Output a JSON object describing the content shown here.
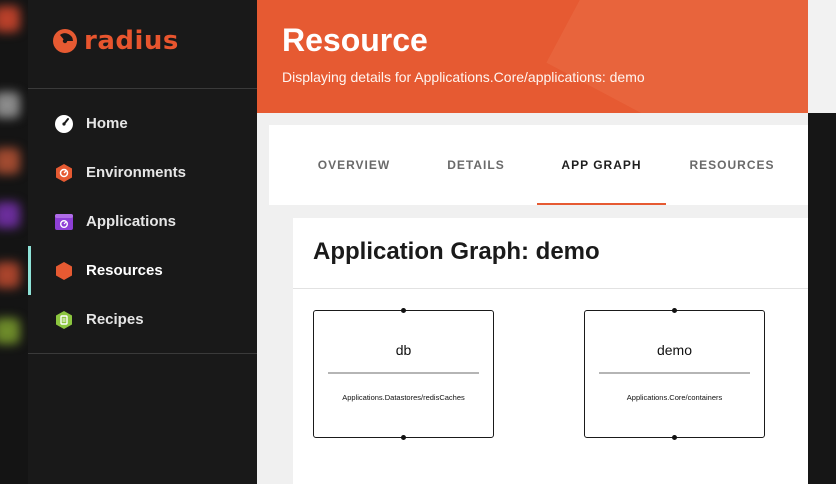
{
  "brand": {
    "name": "radius",
    "accent": "#e65a32",
    "active_marker": "#8fe3d8"
  },
  "sidebar": {
    "items": [
      {
        "label": "Home",
        "icon": "gauge-icon",
        "active": false
      },
      {
        "label": "Environments",
        "icon": "environments-hexagon-icon",
        "active": false
      },
      {
        "label": "Applications",
        "icon": "applications-window-icon",
        "active": false
      },
      {
        "label": "Resources",
        "icon": "resources-hexagon-icon",
        "active": true
      },
      {
        "label": "Recipes",
        "icon": "recipes-hexagon-icon",
        "active": false
      }
    ]
  },
  "header": {
    "title": "Resource",
    "subtitle": "Displaying details for Applications.Core/applications: demo"
  },
  "tabs": [
    {
      "label": "OVERVIEW",
      "active": false
    },
    {
      "label": "DETAILS",
      "active": false
    },
    {
      "label": "APP GRAPH",
      "active": true
    },
    {
      "label": "RESOURCES",
      "active": false
    }
  ],
  "graph": {
    "title": "Application Graph: demo",
    "nodes": [
      {
        "name": "db",
        "type": "Applications.Datastores/redisCaches"
      },
      {
        "name": "demo",
        "type": "Applications.Core/containers"
      }
    ]
  }
}
